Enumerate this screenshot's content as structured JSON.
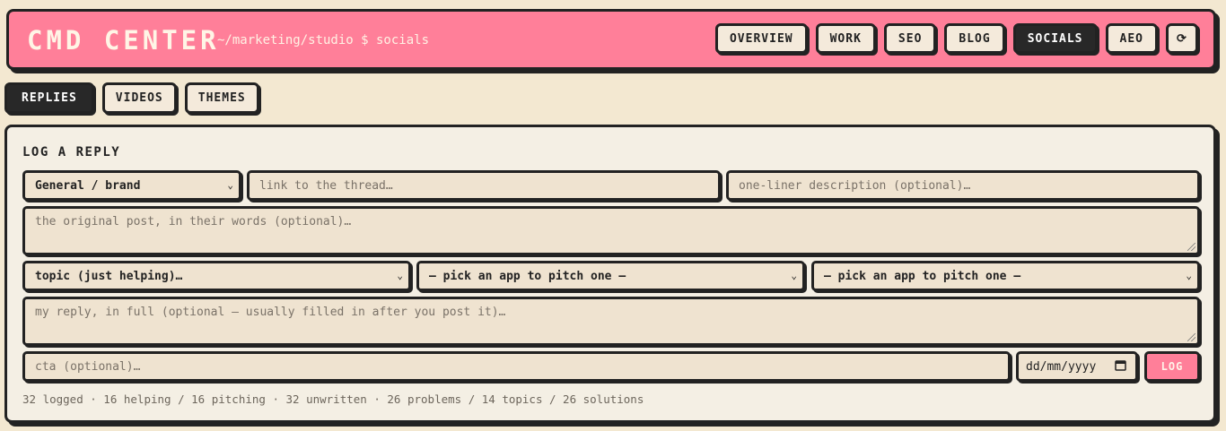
{
  "header": {
    "title": "CMD CENTER",
    "path": "~/marketing/studio $ socials",
    "nav": [
      {
        "label": "OVERVIEW",
        "active": false
      },
      {
        "label": "WORK",
        "active": false
      },
      {
        "label": "SEO",
        "active": false
      },
      {
        "label": "BLOG",
        "active": false
      },
      {
        "label": "SOCIALS",
        "active": true
      },
      {
        "label": "AEO",
        "active": false
      }
    ],
    "refresh_icon": "⟳"
  },
  "tabs": [
    {
      "label": "REPLIES",
      "active": true
    },
    {
      "label": "VIDEOS",
      "active": false
    },
    {
      "label": "THEMES",
      "active": false
    }
  ],
  "form": {
    "title": "LOG A REPLY",
    "category_select": "General / brand",
    "thread_link_placeholder": "link to the thread…",
    "description_placeholder": "one-liner description (optional)…",
    "original_post_placeholder": "the original post, in their words (optional)…",
    "topic_select": "topic (just helping)…",
    "app_select_1": "— pick an app to pitch one —",
    "app_select_2": "— pick an app to pitch one —",
    "reply_placeholder": "my reply, in full (optional — usually filled in after you post it)…",
    "cta_placeholder": "cta (optional)…",
    "date_placeholder": "dd/mm/yyyy",
    "log_button": "LOG"
  },
  "stats": "32 logged · 16 helping / 16 pitching · 32 unwritten · 26 problems / 14 topics / 26 solutions",
  "colors": {
    "background": "#f3e8d1",
    "accent_pink": "#ff7f99",
    "dark": "#282828",
    "input_bg": "#efe3d0"
  }
}
